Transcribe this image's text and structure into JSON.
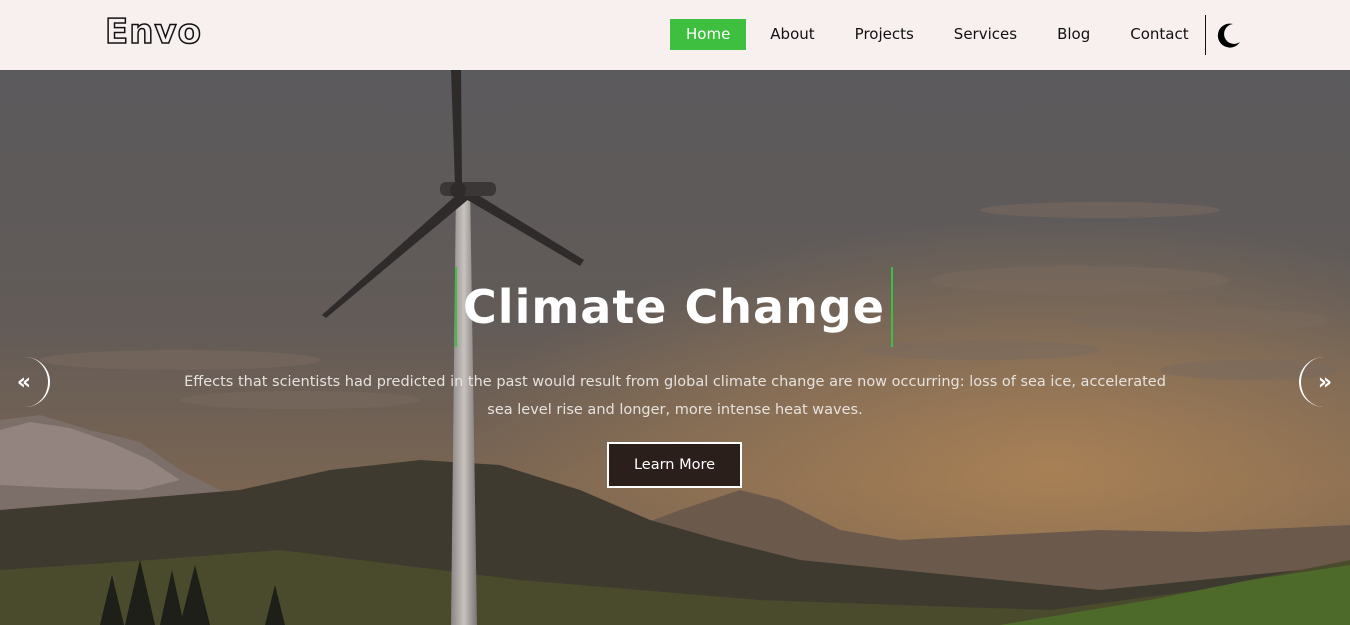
{
  "brand": {
    "logo_text": "Envo"
  },
  "nav": {
    "items": [
      {
        "label": "Home",
        "active": true
      },
      {
        "label": "About",
        "active": false
      },
      {
        "label": "Projects",
        "active": false
      },
      {
        "label": "Services",
        "active": false
      },
      {
        "label": "Blog",
        "active": false
      },
      {
        "label": "Contact",
        "active": false
      }
    ],
    "theme_toggle_icon": "moon-icon"
  },
  "hero": {
    "title": "Climate Change",
    "description": "Effects that scientists had predicted in the past would result from global climate change are now occurring: loss of sea ice, accelerated sea level rise and longer, more intense heat waves.",
    "cta_label": "Learn More",
    "prev_arrow": "«",
    "next_arrow": "»",
    "prev_icon": "double-chevron-left-icon",
    "next_icon": "double-chevron-right-icon"
  },
  "colors": {
    "accent": "#3fbf3f",
    "header_bg": "#f8efef",
    "button_bg": "#2a1f1b"
  }
}
